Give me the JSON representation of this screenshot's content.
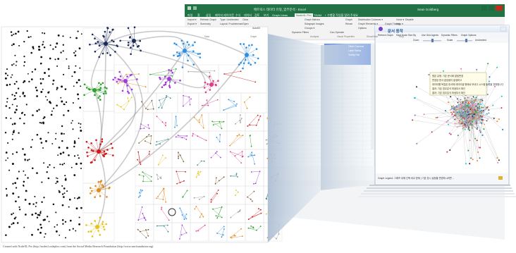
{
  "caption": "Created with NodeXL Pro (http://nodexl.codeplex.com) from the Social Media Research Foundation (http://www.smrfoundation.org)",
  "excel": {
    "title": "매트릭스 데이터 유형_업무분석 - Excel",
    "user": "Sean Goldberg",
    "tabs": [
      "파일",
      "홈",
      "삽입",
      "페이지 레이아웃",
      "수식",
      "데이터",
      "검토",
      "보기",
      "Graph Ideas",
      "NodeXL Pro",
      "TEAM",
      "♀ 수행할 작업을 알려 주세요"
    ],
    "active_tab": "NodeXL Pro",
    "ribbon_items": [
      "Import ▾",
      "Refresh Graph",
      "Type: Undirected",
      "Export ▾",
      "Summary",
      "Layout: Fruchterman",
      "Clear",
      "Open",
      "Autofill",
      "Graph Metrics",
      "Subgraph Images",
      "Groups ▾",
      "Dynamic Filters",
      "Can Operate",
      "Graph",
      "Reuse",
      "Distribution Columns ▾",
      "Graph Elements ▾",
      "Options",
      "Voice ▾",
      "Graph Theory",
      "Help ▾",
      "Disable"
    ],
    "ribbon_groups": [
      "Data",
      "Graph",
      "Analysis",
      "Visual Properties",
      "Show/Hide",
      "Help"
    ],
    "sheet_cells": [
      "Other Columns",
      "Label Ratios",
      "Tooltip Pair"
    ],
    "highlight_color": "#4b7bd4"
  },
  "graph_window": {
    "title": "문서 동작",
    "toolbar_items": [
      "Refresh Graph",
      "Hard Node Size By",
      "Use Grid Agents",
      "Dynamic Filters",
      "Graph Options"
    ],
    "toolbar2": [
      "Zoom",
      "Scale",
      "Undirected"
    ],
    "tooltip_lines": [
      "원본 유형: 기존 문서에 알림변경",
      "변경된 문서 없었음이 발생하고",
      "데이터를 독립된 문서에 데이터셀 형태로 보내고 시스템 등록을 표현합니다",
      "결과: 기존 업무분석 파생부서 확인",
      "결과: 기존 업무분석 파생부서 확인"
    ],
    "status_text": "Graph Legend: 그래프 내에 선택 비교 문제 | 기본 표시 설정을 변경하시려면 ..."
  },
  "colors": {
    "excel_green": "#217346",
    "ribbon_bg": "#f3f3f3",
    "group_navy": "#1a2a5a",
    "group_blue": "#2f8ee0",
    "group_purple": "#a03ad8",
    "group_green": "#2ea02e",
    "group_red": "#cc1818",
    "group_orange": "#e08a1e",
    "group_yellow": "#e5c21c",
    "group_pink": "#e03c8c"
  }
}
